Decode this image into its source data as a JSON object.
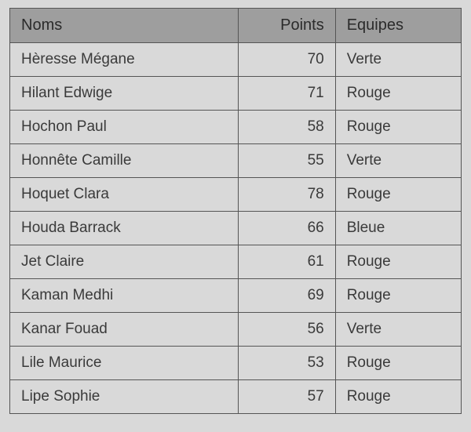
{
  "table": {
    "headers": {
      "name": "Noms",
      "points": "Points",
      "team": "Equipes"
    },
    "rows": [
      {
        "name": "Hèresse Mégane",
        "points": "70",
        "team": "Verte"
      },
      {
        "name": "Hilant Edwige",
        "points": "71",
        "team": "Rouge"
      },
      {
        "name": "Hochon Paul",
        "points": "58",
        "team": "Rouge"
      },
      {
        "name": "Honnête Camille",
        "points": "55",
        "team": "Verte"
      },
      {
        "name": "Hoquet Clara",
        "points": "78",
        "team": "Rouge"
      },
      {
        "name": "Houda Barrack",
        "points": "66",
        "team": "Bleue"
      },
      {
        "name": "Jet Claire",
        "points": "61",
        "team": "Rouge"
      },
      {
        "name": "Kaman Medhi",
        "points": "69",
        "team": "Rouge"
      },
      {
        "name": "Kanar Fouad",
        "points": "56",
        "team": "Verte"
      },
      {
        "name": "Lile Maurice",
        "points": "53",
        "team": "Rouge"
      },
      {
        "name": "Lipe Sophie",
        "points": "57",
        "team": "Rouge"
      }
    ]
  }
}
